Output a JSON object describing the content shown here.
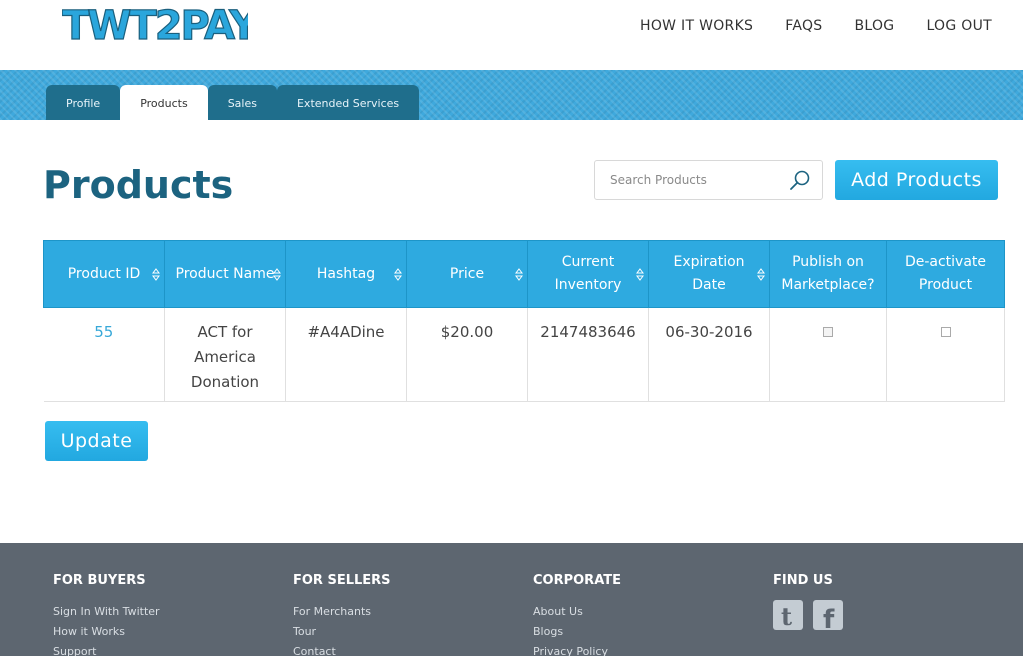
{
  "brand": {
    "logo_text": "TWT2PAY",
    "accent": "#2eaae0",
    "dark": "#1c6380"
  },
  "nav": {
    "items": [
      "HOW IT WORKS",
      "FAQS",
      "BLOG",
      "LOG OUT"
    ]
  },
  "tabs": [
    "Profile",
    "Products",
    "Sales",
    "Extended Services"
  ],
  "active_tab": "Products",
  "page": {
    "title": "Products"
  },
  "search": {
    "placeholder": "Search Products",
    "value": ""
  },
  "buttons": {
    "add": "Add Products",
    "update": "Update"
  },
  "table": {
    "headers": [
      "Product ID",
      "Product Name",
      "Hashtag",
      "Price",
      "Current Inventory",
      "Expiration Date",
      "Publish on Marketplace?",
      "De-activate Product"
    ],
    "rows": [
      {
        "id": "55",
        "name": "ACT for America Donation",
        "hashtag": "#A4ADine",
        "price": "$20.00",
        "inventory": "2147483646",
        "expiration": "06-30-2016",
        "publish": false,
        "deactivate": false
      }
    ]
  },
  "footer": {
    "buyers": {
      "title": "FOR BUYERS",
      "links": [
        "Sign In With Twitter",
        "How it Works",
        "Support"
      ]
    },
    "sellers": {
      "title": "FOR SELLERS",
      "links": [
        "For Merchants",
        "Tour",
        "Contact"
      ]
    },
    "corporate": {
      "title": "CORPORATE",
      "links": [
        "About Us",
        "Blogs",
        "Privacy Policy"
      ]
    },
    "findus": {
      "title": "FIND US",
      "icons": [
        "twitter-icon",
        "facebook-icon"
      ]
    }
  }
}
